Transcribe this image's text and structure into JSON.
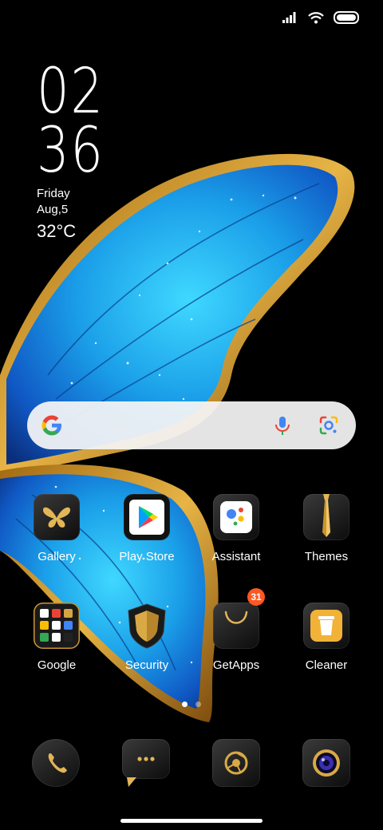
{
  "status_bar": {
    "signal_icon": "cellular-signal-icon",
    "wifi_icon": "wifi-icon",
    "battery_icon": "battery-full-icon"
  },
  "clock_widget": {
    "hour": "02",
    "minute": "36",
    "day": "Friday",
    "date": "Aug,5",
    "temperature": "32°C"
  },
  "search_bar": {
    "logo": "google-g-icon",
    "mic_icon": "microphone-icon",
    "lens_icon": "google-lens-icon"
  },
  "apps": [
    {
      "label": "Gallery",
      "icon": "butterfly-icon"
    },
    {
      "label": "Play Store",
      "icon": "play-store-icon"
    },
    {
      "label": "Assistant",
      "icon": "assistant-icon"
    },
    {
      "label": "Themes",
      "icon": "tie-icon"
    },
    {
      "label": "Google",
      "icon": "google-folder-icon"
    },
    {
      "label": "Security",
      "icon": "shield-icon"
    },
    {
      "label": "GetApps",
      "icon": "shopping-bag-icon",
      "badge": "31"
    },
    {
      "label": "Cleaner",
      "icon": "trash-icon"
    }
  ],
  "page_indicator": {
    "pages": 2,
    "current": 1
  },
  "dock": [
    {
      "icon": "phone-icon"
    },
    {
      "icon": "messages-icon"
    },
    {
      "icon": "browser-icon"
    },
    {
      "icon": "camera-icon"
    }
  ],
  "colors": {
    "accent_gold": "#d4a543",
    "wing_blue": "#1f9fe6",
    "badge": "#ff5722",
    "search_bg": "#f5f5f5"
  }
}
